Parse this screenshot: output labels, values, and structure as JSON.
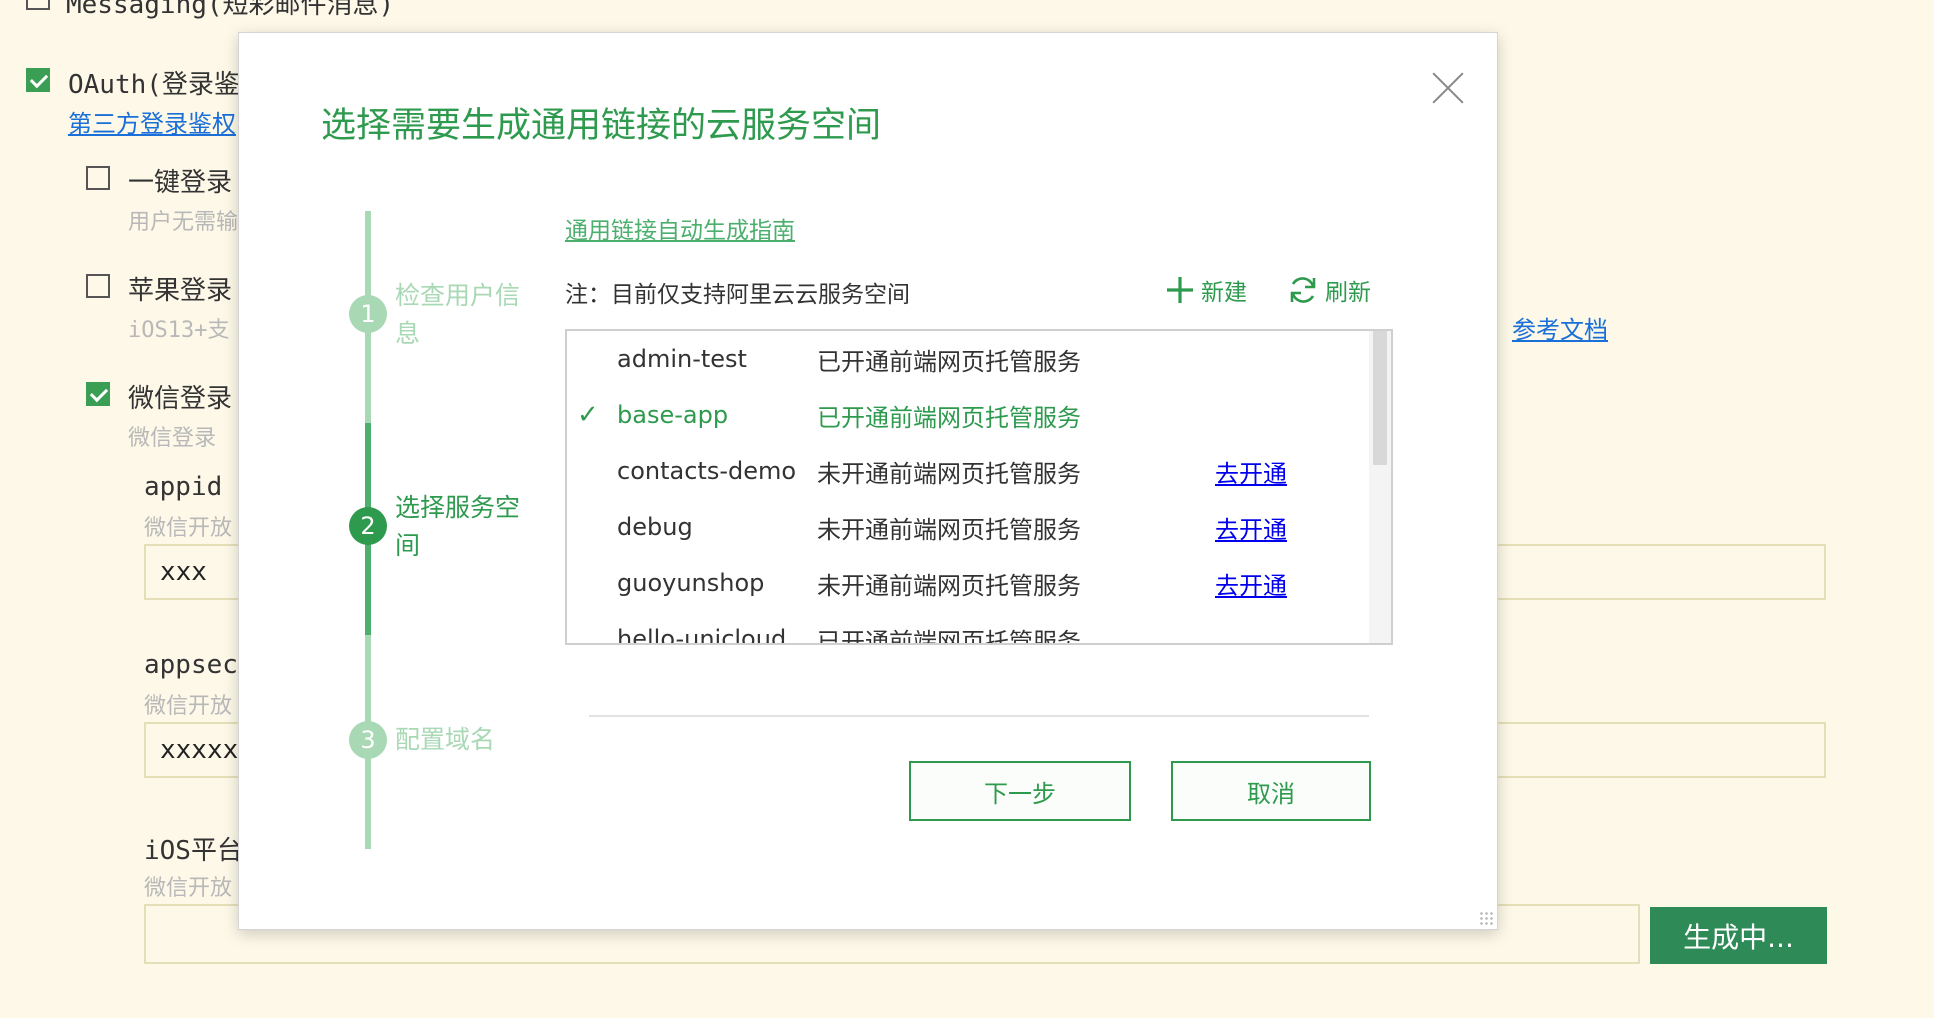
{
  "background": {
    "top_cut_label": "Messaging(短彩邮件消息)",
    "oauth": {
      "label": "OAuth(登录鉴",
      "link": "第三方登录鉴权"
    },
    "options": [
      {
        "label": "一键登录",
        "sub": "用户无需输"
      },
      {
        "label": "苹果登录",
        "sub": "iOS13+支"
      },
      {
        "label": "微信登录",
        "sub": "微信登录"
      }
    ],
    "appid": {
      "label": "appid",
      "sub": "微信开放",
      "value": "xxx"
    },
    "appsecret": {
      "label": "appsec",
      "sub": "微信开放",
      "value": "xxxxx"
    },
    "ios": {
      "label": "iOS平台",
      "sub": "微信开放",
      "value": ""
    },
    "reference_link": "参考文档",
    "generate_button": "生成中..."
  },
  "dialog": {
    "title": "选择需要生成通用链接的云服务空间",
    "steps": [
      {
        "number": "1",
        "label": "检查用户信息",
        "state": "done"
      },
      {
        "number": "2",
        "label": "选择服务空间",
        "state": "active"
      },
      {
        "number": "3",
        "label": "配置域名",
        "state": "pending"
      }
    ],
    "guide_link": "通用链接自动生成指南",
    "note": "注：目前仅支持阿里云云服务空间",
    "new_label": "新建",
    "refresh_label": "刷新",
    "spaces": [
      {
        "name": "admin-test",
        "status": "已开通前端网页托管服务",
        "action": "",
        "selected": false
      },
      {
        "name": "base-app",
        "status": "已开通前端网页托管服务",
        "action": "",
        "selected": true
      },
      {
        "name": "contacts-demo",
        "status": "未开通前端网页托管服务",
        "action": "去开通",
        "selected": false
      },
      {
        "name": "debug",
        "status": "未开通前端网页托管服务",
        "action": "去开通",
        "selected": false
      },
      {
        "name": "guoyunshop",
        "status": "未开通前端网页托管服务",
        "action": "去开通",
        "selected": false
      },
      {
        "name": "hello-unicloud",
        "status": "已开通前端网页托管服务",
        "action": "",
        "selected": false
      }
    ],
    "next_button": "下一步",
    "cancel_button": "取消",
    "colors": {
      "accent": "#2e9a4e",
      "step_done": "#a8d8b4",
      "link_blue": "#0000ee"
    }
  }
}
